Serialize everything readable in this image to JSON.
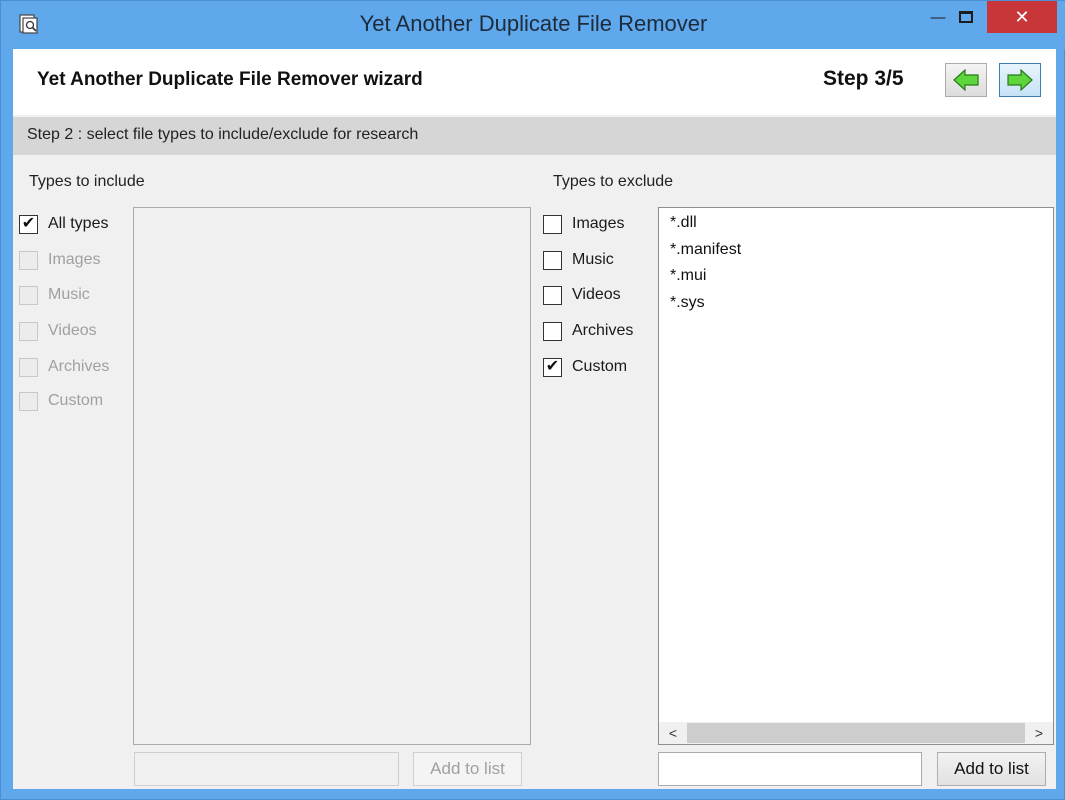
{
  "window": {
    "title": "Yet Another Duplicate File Remover",
    "minimize_glyph": "—",
    "maximize_glyph": "☐",
    "close_glyph": "✕"
  },
  "header": {
    "wizard_title": "Yet Another Duplicate File Remover wizard",
    "step_label": "Step 3/5",
    "back_icon": "green-left-arrow-icon",
    "next_icon": "green-right-arrow-icon"
  },
  "stepbar": {
    "text": "Step 2 : select file types to include/exclude for research"
  },
  "include": {
    "label": "Types to include",
    "options": [
      {
        "label": "All types",
        "checked": true,
        "enabled": true
      },
      {
        "label": "Images",
        "checked": false,
        "enabled": false
      },
      {
        "label": "Music",
        "checked": false,
        "enabled": false
      },
      {
        "label": "Videos",
        "checked": false,
        "enabled": false
      },
      {
        "label": "Archives",
        "checked": false,
        "enabled": false
      },
      {
        "label": "Custom",
        "checked": false,
        "enabled": false
      }
    ],
    "list_items": [],
    "input_value": "",
    "add_button": "Add to list",
    "add_enabled": false
  },
  "exclude": {
    "label": "Types to exclude",
    "options": [
      {
        "label": "Images",
        "checked": false,
        "enabled": true
      },
      {
        "label": "Music",
        "checked": false,
        "enabled": true
      },
      {
        "label": "Videos",
        "checked": false,
        "enabled": true
      },
      {
        "label": "Archives",
        "checked": false,
        "enabled": true
      },
      {
        "label": "Custom",
        "checked": true,
        "enabled": true
      }
    ],
    "list_items": [
      "*.dll",
      "*.manifest",
      "*.mui",
      "*.sys"
    ],
    "input_value": "",
    "add_button": "Add to list",
    "add_enabled": true
  },
  "colors": {
    "titlebar": "#60a8ec",
    "close_button": "#c8363a",
    "stepbar": "#d6d6d6"
  }
}
